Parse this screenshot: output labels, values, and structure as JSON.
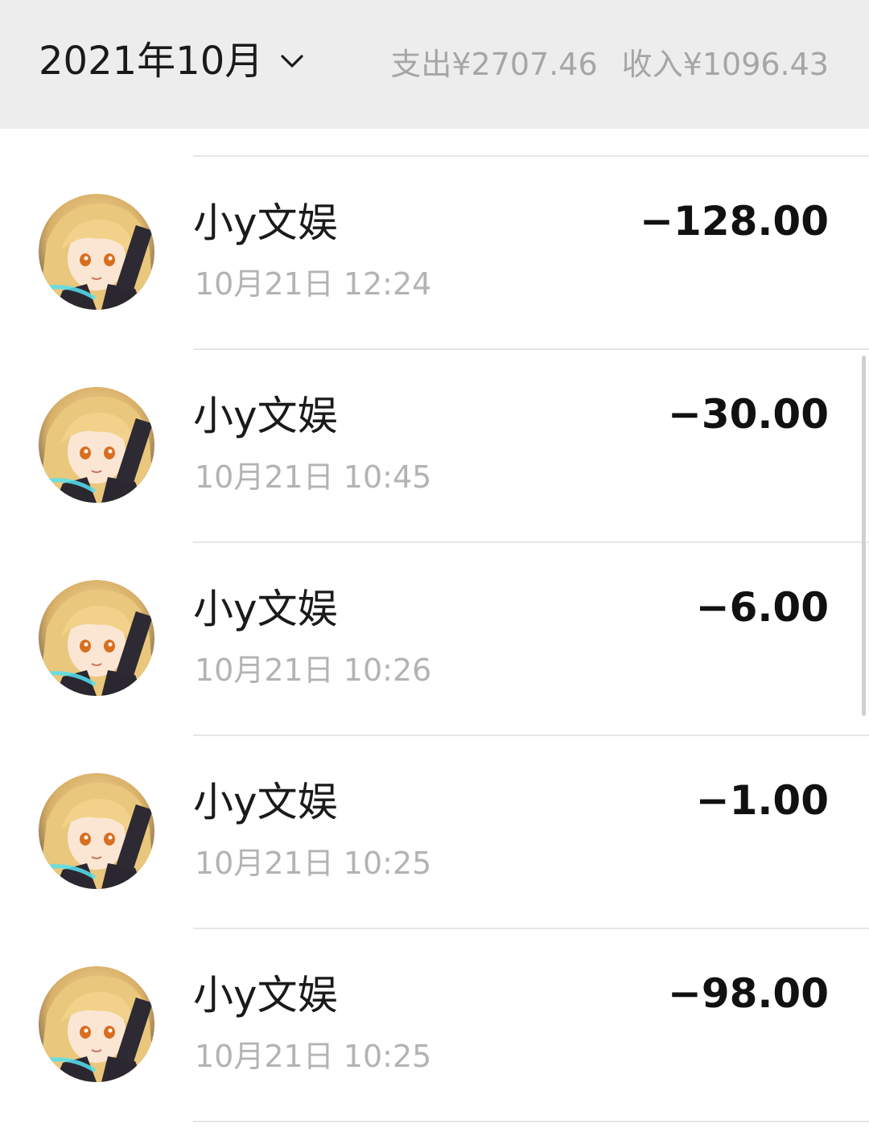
{
  "header": {
    "month_label": "2021年10月",
    "expense_label": "支出¥2707.46",
    "income_label": "收入¥1096.43"
  },
  "transactions": [
    {
      "name": "小y文娱",
      "time": "10月21日 12:24",
      "amount": "−128.00"
    },
    {
      "name": "小y文娱",
      "time": "10月21日 10:45",
      "amount": "−30.00"
    },
    {
      "name": "小y文娱",
      "time": "10月21日 10:26",
      "amount": "−6.00"
    },
    {
      "name": "小y文娱",
      "time": "10月21日 10:25",
      "amount": "−1.00"
    },
    {
      "name": "小y文娱",
      "time": "10月21日 10:25",
      "amount": "−98.00"
    }
  ],
  "icons": {
    "dropdown": "chevron-down-icon",
    "avatar": "anime-avatar-image"
  },
  "colors": {
    "header_bg": "#ededed",
    "primary_text": "#1a1a1a",
    "secondary_text": "#b3b3b3",
    "summary_text": "#a6a6a6"
  }
}
